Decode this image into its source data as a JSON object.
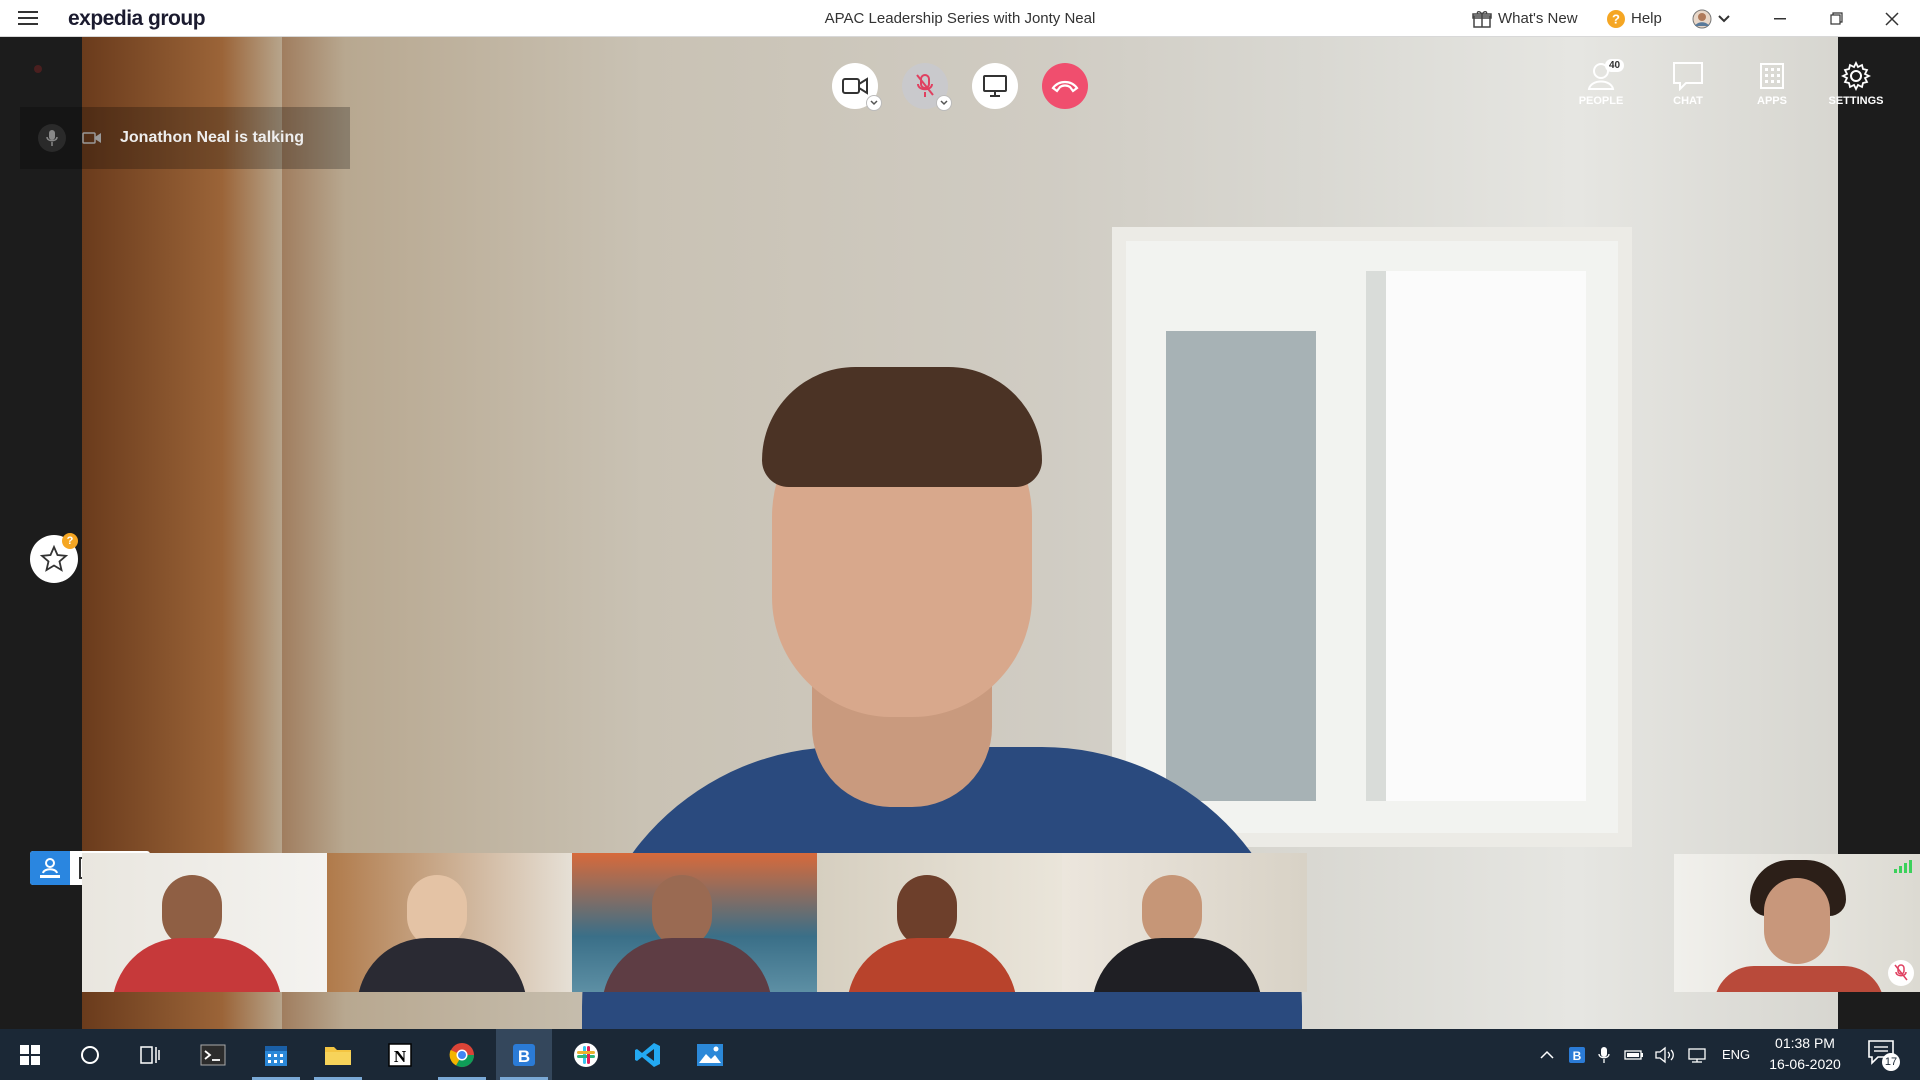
{
  "app": {
    "logo_text": "expedia group",
    "window_title": "APAC Leadership Series with Jonty Neal",
    "whats_new": "What's New",
    "help": "Help"
  },
  "call_controls": {
    "video": "video-camera-icon",
    "mic": "microphone-muted-icon",
    "share": "screen-share-icon",
    "hangup": "hang-up-icon"
  },
  "right_nav": {
    "people_label": "PEOPLE",
    "people_count": "40",
    "chat_label": "CHAT",
    "apps_label": "APPS",
    "settings_label": "SETTINGS"
  },
  "talking_indicator": "Jonathon Neal is talking",
  "star_badge": "?",
  "colors": {
    "hangup": "#f04e6e",
    "layout_active": "#2a86e0",
    "taskbar": "#1b2836"
  },
  "taskbar": {
    "language": "ENG",
    "time": "01:38 PM",
    "date": "16-06-2020",
    "notification_count": "17"
  }
}
